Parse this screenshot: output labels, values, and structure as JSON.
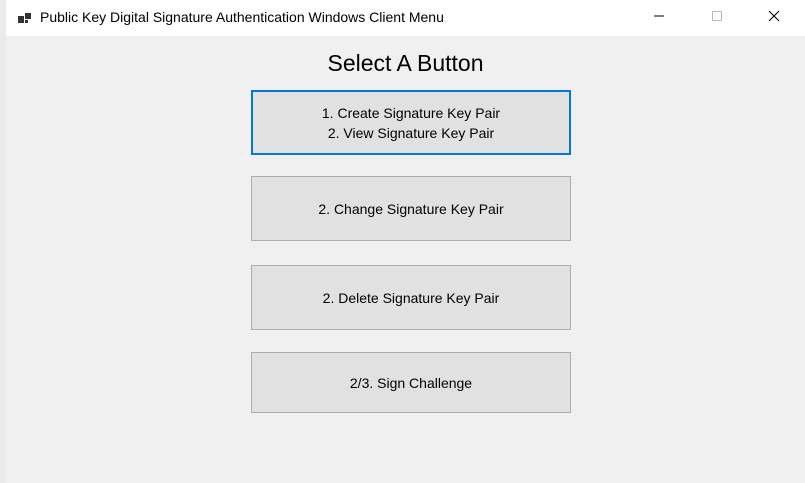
{
  "window": {
    "title": "Public Key Digital Signature Authentication Windows Client Menu",
    "app_icon": "windows-form-icon",
    "controls": {
      "minimize_icon": "minimize-icon",
      "maximize_icon": "maximize-icon",
      "close_icon": "close-icon"
    }
  },
  "main": {
    "heading": "Select A Button",
    "buttons": [
      {
        "lines": [
          "1. Create Signature Key Pair",
          "2. View Signature Key Pair"
        ],
        "focused": true
      },
      {
        "lines": [
          "2. Change Signature Key Pair"
        ]
      },
      {
        "lines": [
          "2. Delete Signature Key Pair"
        ]
      },
      {
        "lines": [
          "2/3. Sign Challenge"
        ]
      }
    ]
  },
  "colors": {
    "focus_border": "#0078d7",
    "button_face": "#e1e1e1",
    "window_background": "#f0f0f0"
  }
}
